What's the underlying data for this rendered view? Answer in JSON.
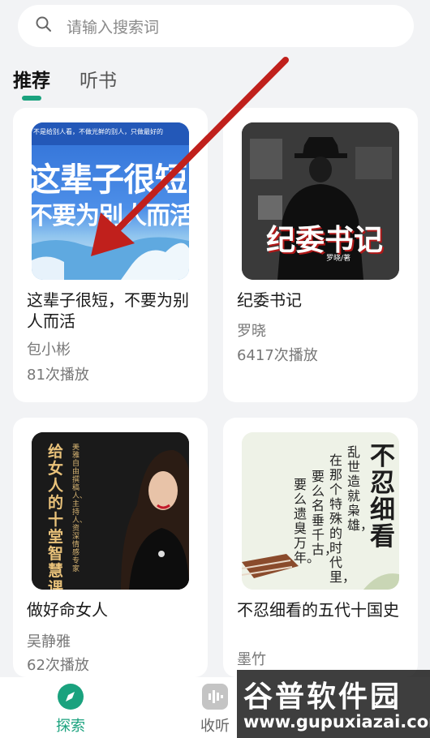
{
  "search": {
    "placeholder": "请输入搜索词",
    "icon": "search-icon"
  },
  "tabs": [
    {
      "label": "推荐",
      "active": true
    },
    {
      "label": "听书",
      "active": false
    }
  ],
  "books": [
    {
      "title": "这辈子很短，不要为别人而活",
      "author": "包小彬",
      "plays": "81次播放",
      "cover": {
        "banner": "不是给别人看，不做光鲜的别人，只做最好的",
        "line1": "这辈子很短",
        "line2": "不要为别人而活"
      }
    },
    {
      "title": "纪委书记",
      "author": "罗晓",
      "plays": "6417次播放",
      "cover": {
        "title": "纪委书记",
        "author": "罗晓/著"
      }
    },
    {
      "title": "做好命女人",
      "author": "吴静雅",
      "plays": "62次播放",
      "cover": {
        "title": "给女人的十堂智慧课",
        "byline": "美雅 自由撰稿人、主持人、资深情感专家"
      }
    },
    {
      "title": "不忍细看的五代十国史",
      "author": "墨竹",
      "plays": "",
      "cover": {
        "title": "不忍细看",
        "poem": [
          "乱世造就枭雄，",
          "在那个特殊的时代里，",
          "要么名垂千古，",
          "要么遗臭万年。"
        ]
      }
    }
  ],
  "nav": [
    {
      "label": "探索",
      "active": true
    },
    {
      "label": "收听",
      "active": false
    }
  ],
  "watermark": {
    "text": "谷普软件园",
    "url": "www.gupuxiazai.com"
  },
  "colors": {
    "accent": "#1aa27e",
    "annotation_arrow": "#c0201c"
  }
}
